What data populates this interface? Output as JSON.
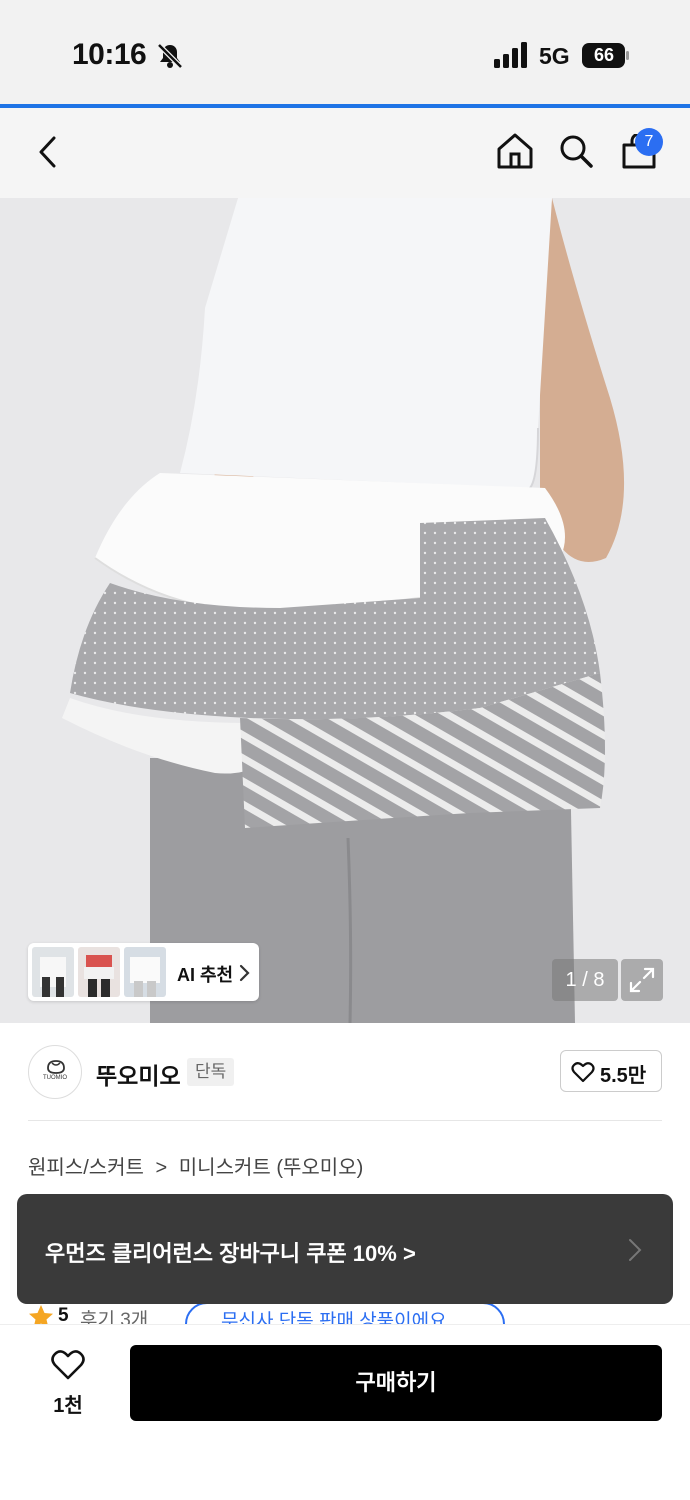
{
  "status_bar": {
    "time": "10:16",
    "network": "5G",
    "battery": "66",
    "icons": [
      "bell-slash-icon",
      "signal-bars-icon",
      "battery-icon"
    ]
  },
  "nav": {
    "icons": [
      "back-chevron-icon",
      "home-icon",
      "search-icon",
      "cart-icon"
    ],
    "cart_badge": "7"
  },
  "gallery": {
    "page_indicator": "1 / 8",
    "ai_recommend_label": "AI 추천",
    "expand_icon": "expand-arrows-icon"
  },
  "brand": {
    "logo_text": "TUOMIO",
    "name": "뚜오미오",
    "tag": "단독",
    "likes": "5.5만"
  },
  "breadcrumb": {
    "category": "원피스/스커트",
    "separator": ">",
    "subcategory": "미니스커트 (뚜오미오)"
  },
  "toast": {
    "message": "우먼즈 클리어런스 장바구니 쿠폰 10% >"
  },
  "rating": {
    "score": "5",
    "reviews": "후기 3개",
    "pill": "무신사 단독 판매 상품이에요"
  },
  "bottom_bar": {
    "wish_count": "1천",
    "buy_label": "구매하기"
  },
  "colors": {
    "accent": "#2b6ef2",
    "toast_bg": "#3a3a3a",
    "buy_bg": "#000000",
    "star": "#f5a623"
  }
}
